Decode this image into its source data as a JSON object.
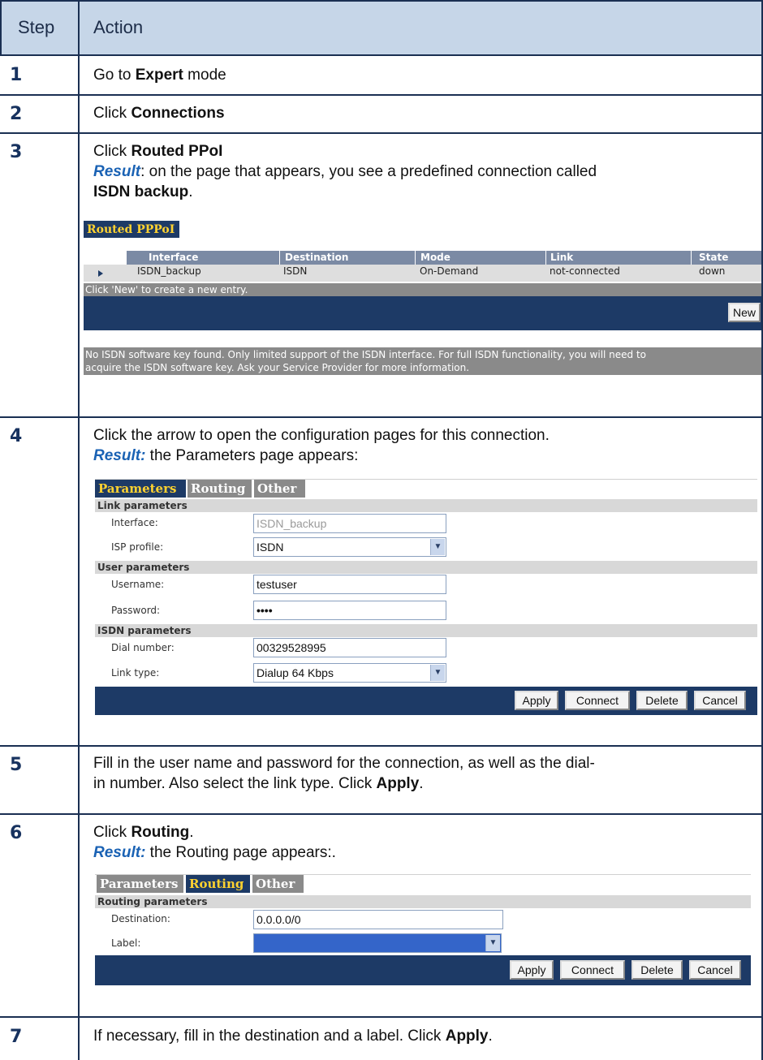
{
  "header": {
    "step": "Step",
    "action": "Action"
  },
  "steps": [
    {
      "num": "1",
      "pre": "Go to ",
      "bold": "Expert",
      "post": " mode"
    },
    {
      "num": "2",
      "pre": "Click ",
      "bold": "Connections",
      "post": ""
    },
    {
      "num": "3",
      "pre": "Click ",
      "bold": "Routed PPoI",
      "post": "",
      "result_label": "Result",
      "result_text": ": on the page that appears, you see a predefined connection called",
      "result_bold": "ISDN backup",
      "result_end": "."
    },
    {
      "num": "4",
      "line1": "Click the arrow to open the configuration pages for this connection.",
      "result_label": "Result:",
      "result_text": " the Parameters page appears:"
    },
    {
      "num": "5",
      "line1": "Fill in the user name and password for the connection, as well as the dial-",
      "line2_pre": "in number. Also select the link type. Click ",
      "line2_bold": "Apply",
      "line2_post": "."
    },
    {
      "num": "6",
      "pre": "Click ",
      "bold": "Routing",
      "post": ".",
      "result_label": "Result:",
      "result_text": " the Routing page appears:."
    },
    {
      "num": "7",
      "pre": "If necessary, fill in the destination and a label. Click ",
      "bold": "Apply",
      "post": "."
    }
  ],
  "routed_screen": {
    "title": "Routed PPPoI",
    "columns": [
      "Interface",
      "Destination",
      "Mode",
      "Link",
      "State"
    ],
    "row": [
      "ISDN_backup",
      "ISDN",
      "On-Demand",
      "not-connected",
      "down"
    ],
    "hint": "Click 'New' to create a new entry.",
    "new_button": "New",
    "note_line1": "No ISDN software key found. Only limited support of the ISDN interface. For full ISDN functionality, you will need to",
    "note_line2": "acquire the ISDN software key. Ask your Service Provider for more information."
  },
  "params_screen": {
    "tabs": [
      "Parameters",
      "Routing",
      "Other"
    ],
    "link_section": "Link parameters",
    "interface_label": "Interface:",
    "interface_value": "ISDN_backup",
    "isp_label": "ISP profile:",
    "isp_value": "ISDN",
    "user_section": "User parameters",
    "username_label": "Username:",
    "username_value": "testuser",
    "password_label": "Password:",
    "password_value": "••••",
    "isdn_section": "ISDN parameters",
    "dial_label": "Dial number:",
    "dial_value": "00329528995",
    "linktype_label": "Link type:",
    "linktype_value": "Dialup 64 Kbps",
    "buttons": [
      "Apply",
      "Connect",
      "Delete",
      "Cancel"
    ]
  },
  "routing_screen": {
    "tabs": [
      "Parameters",
      "Routing",
      "Other"
    ],
    "section": "Routing parameters",
    "destination_label": "Destination:",
    "destination_value": "0.0.0.0/0",
    "label_label": "Label:",
    "label_value": "",
    "buttons": [
      "Apply",
      "Connect",
      "Delete",
      "Cancel"
    ]
  },
  "colors": {
    "rule": "#1a2f52",
    "header_bg": "#c6d6e8",
    "result": "#1a62b4",
    "app_bar": "#1d3a66",
    "tab_accent": "#ffd230"
  }
}
